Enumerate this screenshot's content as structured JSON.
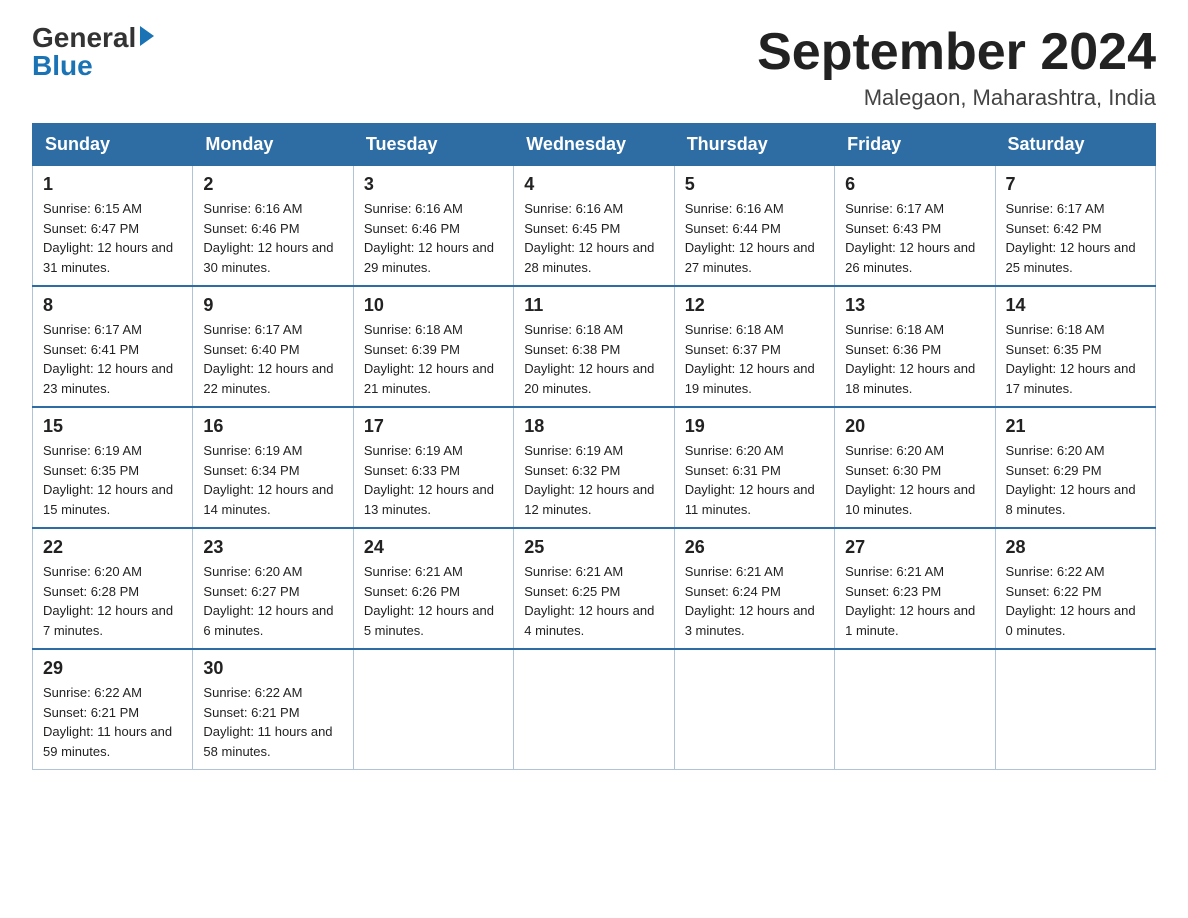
{
  "header": {
    "logo_general": "General",
    "logo_blue": "Blue",
    "title": "September 2024",
    "subtitle": "Malegaon, Maharashtra, India"
  },
  "days_of_week": [
    "Sunday",
    "Monday",
    "Tuesday",
    "Wednesday",
    "Thursday",
    "Friday",
    "Saturday"
  ],
  "weeks": [
    [
      {
        "day": 1,
        "sunrise": "6:15 AM",
        "sunset": "6:47 PM",
        "daylight": "12 hours and 31 minutes."
      },
      {
        "day": 2,
        "sunrise": "6:16 AM",
        "sunset": "6:46 PM",
        "daylight": "12 hours and 30 minutes."
      },
      {
        "day": 3,
        "sunrise": "6:16 AM",
        "sunset": "6:46 PM",
        "daylight": "12 hours and 29 minutes."
      },
      {
        "day": 4,
        "sunrise": "6:16 AM",
        "sunset": "6:45 PM",
        "daylight": "12 hours and 28 minutes."
      },
      {
        "day": 5,
        "sunrise": "6:16 AM",
        "sunset": "6:44 PM",
        "daylight": "12 hours and 27 minutes."
      },
      {
        "day": 6,
        "sunrise": "6:17 AM",
        "sunset": "6:43 PM",
        "daylight": "12 hours and 26 minutes."
      },
      {
        "day": 7,
        "sunrise": "6:17 AM",
        "sunset": "6:42 PM",
        "daylight": "12 hours and 25 minutes."
      }
    ],
    [
      {
        "day": 8,
        "sunrise": "6:17 AM",
        "sunset": "6:41 PM",
        "daylight": "12 hours and 23 minutes."
      },
      {
        "day": 9,
        "sunrise": "6:17 AM",
        "sunset": "6:40 PM",
        "daylight": "12 hours and 22 minutes."
      },
      {
        "day": 10,
        "sunrise": "6:18 AM",
        "sunset": "6:39 PM",
        "daylight": "12 hours and 21 minutes."
      },
      {
        "day": 11,
        "sunrise": "6:18 AM",
        "sunset": "6:38 PM",
        "daylight": "12 hours and 20 minutes."
      },
      {
        "day": 12,
        "sunrise": "6:18 AM",
        "sunset": "6:37 PM",
        "daylight": "12 hours and 19 minutes."
      },
      {
        "day": 13,
        "sunrise": "6:18 AM",
        "sunset": "6:36 PM",
        "daylight": "12 hours and 18 minutes."
      },
      {
        "day": 14,
        "sunrise": "6:18 AM",
        "sunset": "6:35 PM",
        "daylight": "12 hours and 17 minutes."
      }
    ],
    [
      {
        "day": 15,
        "sunrise": "6:19 AM",
        "sunset": "6:35 PM",
        "daylight": "12 hours and 15 minutes."
      },
      {
        "day": 16,
        "sunrise": "6:19 AM",
        "sunset": "6:34 PM",
        "daylight": "12 hours and 14 minutes."
      },
      {
        "day": 17,
        "sunrise": "6:19 AM",
        "sunset": "6:33 PM",
        "daylight": "12 hours and 13 minutes."
      },
      {
        "day": 18,
        "sunrise": "6:19 AM",
        "sunset": "6:32 PM",
        "daylight": "12 hours and 12 minutes."
      },
      {
        "day": 19,
        "sunrise": "6:20 AM",
        "sunset": "6:31 PM",
        "daylight": "12 hours and 11 minutes."
      },
      {
        "day": 20,
        "sunrise": "6:20 AM",
        "sunset": "6:30 PM",
        "daylight": "12 hours and 10 minutes."
      },
      {
        "day": 21,
        "sunrise": "6:20 AM",
        "sunset": "6:29 PM",
        "daylight": "12 hours and 8 minutes."
      }
    ],
    [
      {
        "day": 22,
        "sunrise": "6:20 AM",
        "sunset": "6:28 PM",
        "daylight": "12 hours and 7 minutes."
      },
      {
        "day": 23,
        "sunrise": "6:20 AM",
        "sunset": "6:27 PM",
        "daylight": "12 hours and 6 minutes."
      },
      {
        "day": 24,
        "sunrise": "6:21 AM",
        "sunset": "6:26 PM",
        "daylight": "12 hours and 5 minutes."
      },
      {
        "day": 25,
        "sunrise": "6:21 AM",
        "sunset": "6:25 PM",
        "daylight": "12 hours and 4 minutes."
      },
      {
        "day": 26,
        "sunrise": "6:21 AM",
        "sunset": "6:24 PM",
        "daylight": "12 hours and 3 minutes."
      },
      {
        "day": 27,
        "sunrise": "6:21 AM",
        "sunset": "6:23 PM",
        "daylight": "12 hours and 1 minute."
      },
      {
        "day": 28,
        "sunrise": "6:22 AM",
        "sunset": "6:22 PM",
        "daylight": "12 hours and 0 minutes."
      }
    ],
    [
      {
        "day": 29,
        "sunrise": "6:22 AM",
        "sunset": "6:21 PM",
        "daylight": "11 hours and 59 minutes."
      },
      {
        "day": 30,
        "sunrise": "6:22 AM",
        "sunset": "6:21 PM",
        "daylight": "11 hours and 58 minutes."
      },
      null,
      null,
      null,
      null,
      null
    ]
  ]
}
